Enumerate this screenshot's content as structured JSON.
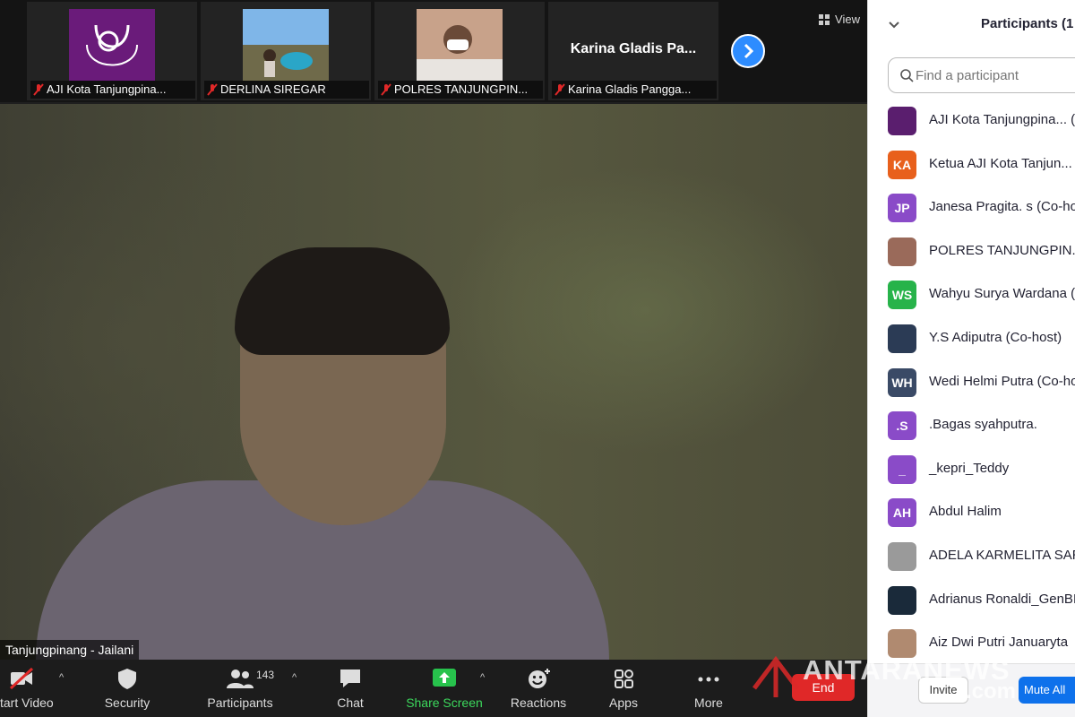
{
  "thumbnails": [
    {
      "name": "AJI Kota Tanjungpina...",
      "kind": "logo"
    },
    {
      "name": "DERLINA SIREGAR",
      "kind": "photo"
    },
    {
      "name": "POLRES TANJUNGPIN...",
      "kind": "photo"
    },
    {
      "name": "Karina Gladis Pangga...",
      "display_name": "Karina Gladis Pa...",
      "kind": "text"
    }
  ],
  "view_label": "View",
  "speaker_label": "Tanjungpinang - Jailani",
  "toolbar": {
    "start_video": "tart Video",
    "security": "Security",
    "participants": "Participants",
    "participants_count": "143",
    "chat": "Chat",
    "share_screen": "Share Screen",
    "reactions": "Reactions",
    "apps": "Apps",
    "more": "More",
    "end": "End"
  },
  "panel": {
    "title": "Participants (1",
    "search_placeholder": "Find a participant",
    "invite": "Invite",
    "mute_all": "Mute All"
  },
  "participants": [
    {
      "initials": "",
      "name": "AJI Kota Tanjungpina... (",
      "color": "#5a1e6e"
    },
    {
      "initials": "KA",
      "name": "Ketua AJI Kota Tanjun...",
      "color": "#e8601c"
    },
    {
      "initials": "JP",
      "name": "Janesa Pragita. s (Co-ho",
      "color": "#8a4bc8"
    },
    {
      "initials": "",
      "name": "POLRES TANJUNGPIN...",
      "color": "#9a6a5a"
    },
    {
      "initials": "WS",
      "name": "Wahyu Surya Wardana (",
      "color": "#27b34a"
    },
    {
      "initials": "",
      "name": "Y.S Adiputra (Co-host)",
      "color": "#2b3b55"
    },
    {
      "initials": "WH",
      "name": "Wedi Helmi Putra (Co-ho",
      "color": "#3a4a66"
    },
    {
      "initials": ".S",
      "name": ".Bagas syahputra.",
      "color": "#8a4bc8"
    },
    {
      "initials": "_",
      "name": "_kepri_Teddy",
      "color": "#8a4bc8"
    },
    {
      "initials": "AH",
      "name": "Abdul Halim",
      "color": "#8a4bc8"
    },
    {
      "initials": "",
      "name": "ADELA KARMELITA SARI",
      "color": "#9a9a9a"
    },
    {
      "initials": "",
      "name": "Adrianus Ronaldi_GenBI",
      "color": "#1a2a3a"
    },
    {
      "initials": "",
      "name": "Aiz Dwi Putri Januaryta",
      "color": "#b08a70"
    }
  ],
  "watermark": {
    "brand": "ANTARANEWS",
    "suffix": ".com"
  }
}
